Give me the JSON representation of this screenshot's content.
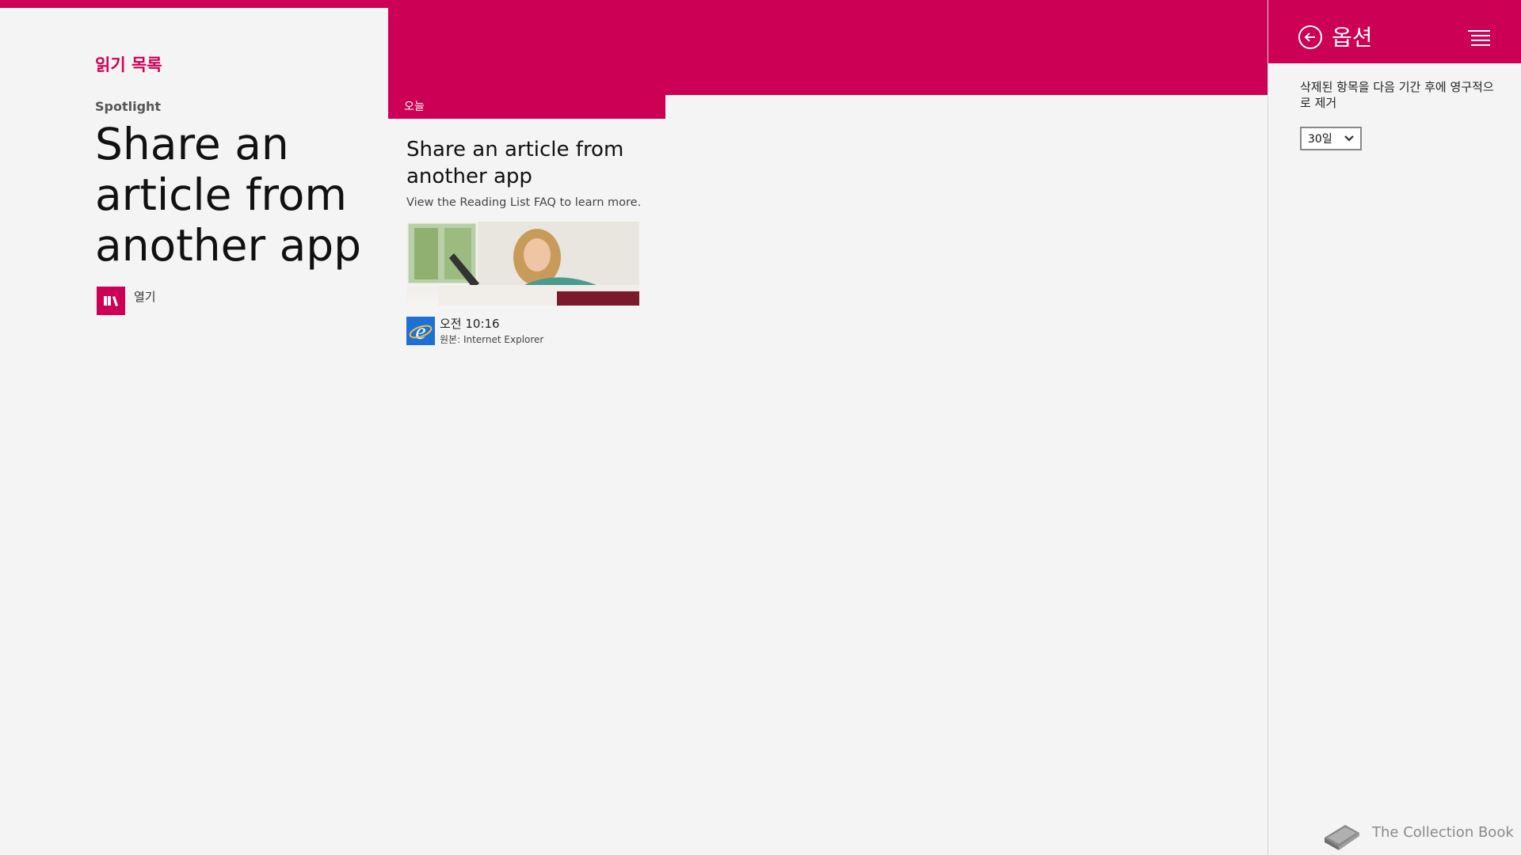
{
  "app": {
    "title": "읽기 목록"
  },
  "spotlight": {
    "label": "Spotlight",
    "title": "Share an article from another app",
    "open_label": "열기"
  },
  "section": {
    "label": "오늘"
  },
  "card": {
    "title": "Share an article from another app",
    "description": "View the Reading List FAQ to learn more.",
    "time": "오전 10:16",
    "source": "원본: Internet Explorer"
  },
  "options": {
    "title": "옵션",
    "setting_label": "삭제된 항목을 다음 기간 후에 영구적으로 제거",
    "select_value": "30일"
  },
  "watermark": "The Collection Book",
  "colors": {
    "accent": "#cc0055",
    "background": "#f4f4f4",
    "ie_blue": "#1e6fd6"
  },
  "icons": [
    "library-icon",
    "internet-explorer-icon",
    "back-arrow-icon",
    "menu-icon",
    "chevron-down-icon",
    "book-icon"
  ]
}
